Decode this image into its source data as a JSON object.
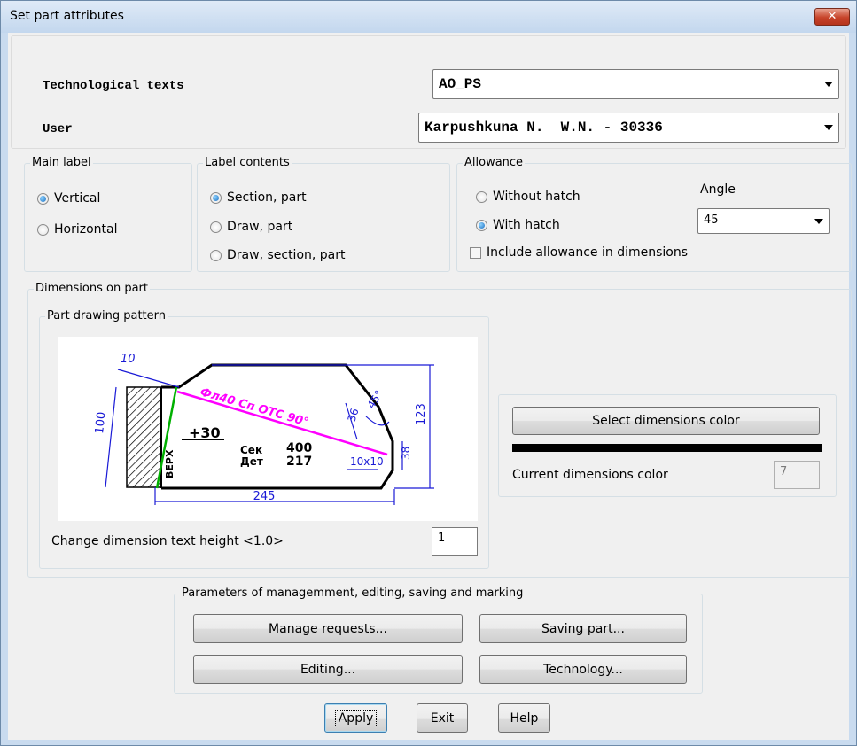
{
  "window": {
    "title": "Set part attributes",
    "close_glyph": "✕"
  },
  "top": {
    "tech_label": "Technological texts",
    "tech_value": "AO_PS",
    "user_label": "User",
    "user_value": "Karpushkuna N.  W.N. - 30336"
  },
  "main_label": {
    "legend": "Main label",
    "options": [
      {
        "label": "Vertical",
        "selected": true
      },
      {
        "label": "Horizontal",
        "selected": false
      }
    ]
  },
  "label_contents": {
    "legend": "Label contents",
    "options": [
      {
        "label": "Section, part",
        "selected": true
      },
      {
        "label": "Draw, part",
        "selected": false
      },
      {
        "label": "Draw, section, part",
        "selected": false
      }
    ]
  },
  "allowance": {
    "legend": "Allowance",
    "options": [
      {
        "label": "Without hatch",
        "selected": false
      },
      {
        "label": "With hatch",
        "selected": true
      }
    ],
    "angle_label": "Angle",
    "angle_value": "45",
    "include_label": "Include allowance in dimensions",
    "include_checked": false
  },
  "dimensions": {
    "legend": "Dimensions on part",
    "pattern_legend": "Part drawing pattern",
    "drawing": {
      "dim_10": "10",
      "dim_100": "100",
      "dim_245": "245",
      "dim_123": "123",
      "dim_36": "36",
      "dim_45": "45°",
      "dim_38": "38",
      "dim_10x10": "10x10",
      "plus30": "+30",
      "sek": "Сек",
      "det": "Дет",
      "num_400": "400",
      "num_217": "217",
      "verh": "ВЕРХ",
      "magenta_text": "Фл40 Сп ОТС 90°"
    },
    "text_height_label": "Change dimension text height <1.0>",
    "text_height_value": "1",
    "select_color_button": "Select dimensions color",
    "current_color_label": "Current dimensions color",
    "current_color_value": "7",
    "color_swatch": "#000000"
  },
  "params": {
    "legend": "Parameters of managemment, editing, saving and marking",
    "manage_requests": "Manage requests...",
    "saving_part": "Saving part...",
    "editing": "Editing...",
    "technology": "Technology..."
  },
  "footer": {
    "apply": "Apply",
    "exit": "Exit",
    "help": "Help"
  }
}
